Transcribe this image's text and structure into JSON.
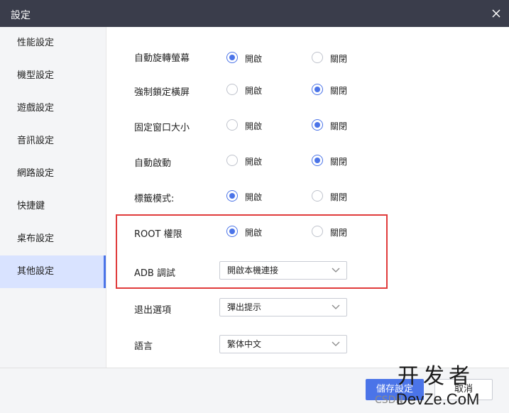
{
  "window": {
    "title": "設定"
  },
  "sidebar": {
    "items": [
      {
        "label": "性能設定"
      },
      {
        "label": "機型設定"
      },
      {
        "label": "遊戲設定"
      },
      {
        "label": "音訊設定"
      },
      {
        "label": "網路設定"
      },
      {
        "label": "快捷鍵"
      },
      {
        "label": "桌布設定"
      },
      {
        "label": "其他設定",
        "active": true
      }
    ]
  },
  "settings": {
    "radio_rows": [
      {
        "label": "自動旋轉螢幕",
        "on_label": "開啟",
        "off_label": "關閉",
        "selected": "on"
      },
      {
        "label": "強制鎖定橫屏",
        "on_label": "開啟",
        "off_label": "關閉",
        "selected": "off"
      },
      {
        "label": "固定窗口大小",
        "on_label": "開啟",
        "off_label": "關閉",
        "selected": "off"
      },
      {
        "label": "自動啟動",
        "on_label": "開啟",
        "off_label": "關閉",
        "selected": "off"
      },
      {
        "label": "標籤模式:",
        "on_label": "開啟",
        "off_label": "關閉",
        "selected": "on"
      },
      {
        "label": "ROOT 權限",
        "on_label": "開啟",
        "off_label": "關閉",
        "selected": "on"
      }
    ],
    "select_rows": [
      {
        "label": "ADB 調試",
        "value": "開啟本機連接"
      },
      {
        "label": "退出選項",
        "value": "彈出提示"
      },
      {
        "label": "語言",
        "value": "繁体中文"
      }
    ]
  },
  "footer": {
    "save_label": "儲存設定",
    "cancel_label": "取消"
  },
  "watermark": {
    "cn": "开发者",
    "en": "DevZe.CoM",
    "csdn": "CSDN"
  },
  "colors": {
    "accent": "#4b74e8",
    "titlebar": "#3a3d4b",
    "highlight": "#e03b3b"
  }
}
